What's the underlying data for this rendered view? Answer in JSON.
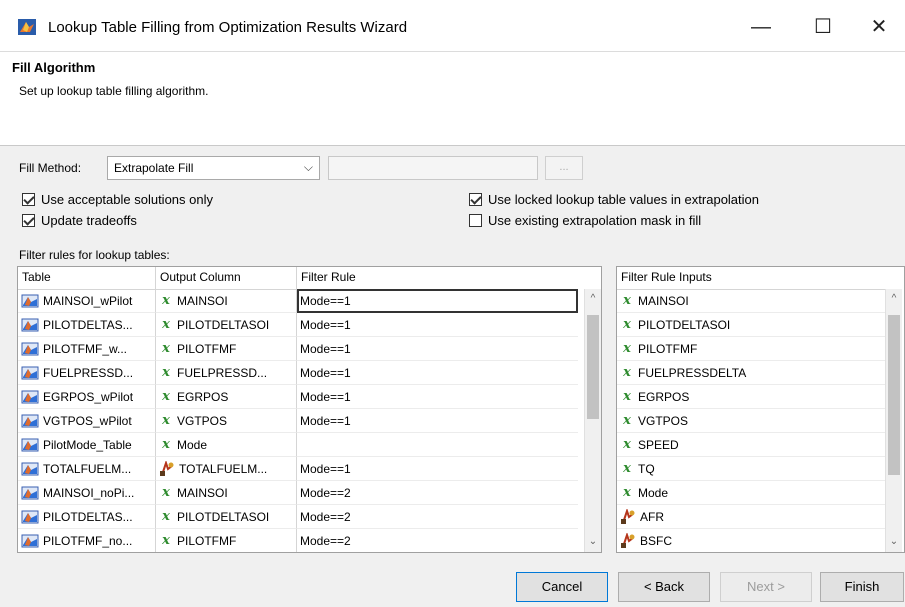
{
  "window": {
    "title": "Lookup Table Filling from Optimization Results Wizard",
    "minimize_glyph": "—",
    "maximize_glyph": "☐",
    "close_glyph": "✕"
  },
  "header": {
    "title": "Fill Algorithm",
    "description": "Set up lookup table filling algorithm."
  },
  "fill_method": {
    "label": "Fill Method:",
    "value": "Extrapolate Fill",
    "chevron": "⌵",
    "browse_label": "..."
  },
  "options": {
    "use_acceptable": {
      "label": "Use acceptable solutions only",
      "checked": true
    },
    "update_tradeoffs": {
      "label": "Update tradeoffs",
      "checked": true
    },
    "use_locked": {
      "label": "Use locked lookup table values in extrapolation",
      "checked": true
    },
    "use_existing_mask": {
      "label": "Use existing extrapolation mask in fill",
      "checked": false
    }
  },
  "filter_rules": {
    "label": "Filter rules for lookup tables:",
    "columns": [
      "Table",
      "Output Column",
      "Filter Rule"
    ],
    "rows": [
      {
        "table": "MAINSOI_wPilot",
        "output": "MAINSOI",
        "output_icon": "x-variable-icon",
        "rule": "Mode==1"
      },
      {
        "table": "PILOTDELTAS...",
        "output": "PILOTDELTASOI",
        "output_icon": "x-variable-icon",
        "rule": "Mode==1"
      },
      {
        "table": "PILOTFMF_w...",
        "output": "PILOTFMF",
        "output_icon": "x-variable-icon",
        "rule": "Mode==1"
      },
      {
        "table": "FUELPRESSD...",
        "output": "FUELPRESSD...",
        "output_icon": "x-variable-icon",
        "rule": "Mode==1"
      },
      {
        "table": "EGRPOS_wPilot",
        "output": "EGRPOS",
        "output_icon": "x-variable-icon",
        "rule": "Mode==1"
      },
      {
        "table": "VGTPOS_wPilot",
        "output": "VGTPOS",
        "output_icon": "x-variable-icon",
        "rule": "Mode==1"
      },
      {
        "table": "PilotMode_Table",
        "output": "Mode",
        "output_icon": "x-variable-icon",
        "rule": ""
      },
      {
        "table": "TOTALFUELM...",
        "output": "TOTALFUELM...",
        "output_icon": "function-icon",
        "rule": "Mode==1"
      },
      {
        "table": "MAINSOI_noPi...",
        "output": "MAINSOI",
        "output_icon": "x-variable-icon",
        "rule": "Mode==2"
      },
      {
        "table": "PILOTDELTAS...",
        "output": "PILOTDELTASOI",
        "output_icon": "x-variable-icon",
        "rule": "Mode==2"
      },
      {
        "table": "PILOTFMF_no...",
        "output": "PILOTFMF",
        "output_icon": "x-variable-icon",
        "rule": "Mode==2"
      }
    ]
  },
  "filter_inputs": {
    "column": "Filter Rule Inputs",
    "items": [
      {
        "name": "MAINSOI",
        "icon": "x-variable-icon"
      },
      {
        "name": "PILOTDELTASOI",
        "icon": "x-variable-icon"
      },
      {
        "name": "PILOTFMF",
        "icon": "x-variable-icon"
      },
      {
        "name": "FUELPRESSDELTA",
        "icon": "x-variable-icon"
      },
      {
        "name": "EGRPOS",
        "icon": "x-variable-icon"
      },
      {
        "name": "VGTPOS",
        "icon": "x-variable-icon"
      },
      {
        "name": "SPEED",
        "icon": "x-variable-icon"
      },
      {
        "name": "TQ",
        "icon": "x-variable-icon"
      },
      {
        "name": "Mode",
        "icon": "x-variable-icon"
      },
      {
        "name": "AFR",
        "icon": "function-icon"
      },
      {
        "name": "BSFC",
        "icon": "function-icon"
      }
    ]
  },
  "x_glyph": "x",
  "scroll_up": "^",
  "scroll_down": "⌄",
  "buttons": {
    "cancel": "Cancel",
    "back": "< Back",
    "next": "Next >",
    "finish": "Finish"
  }
}
